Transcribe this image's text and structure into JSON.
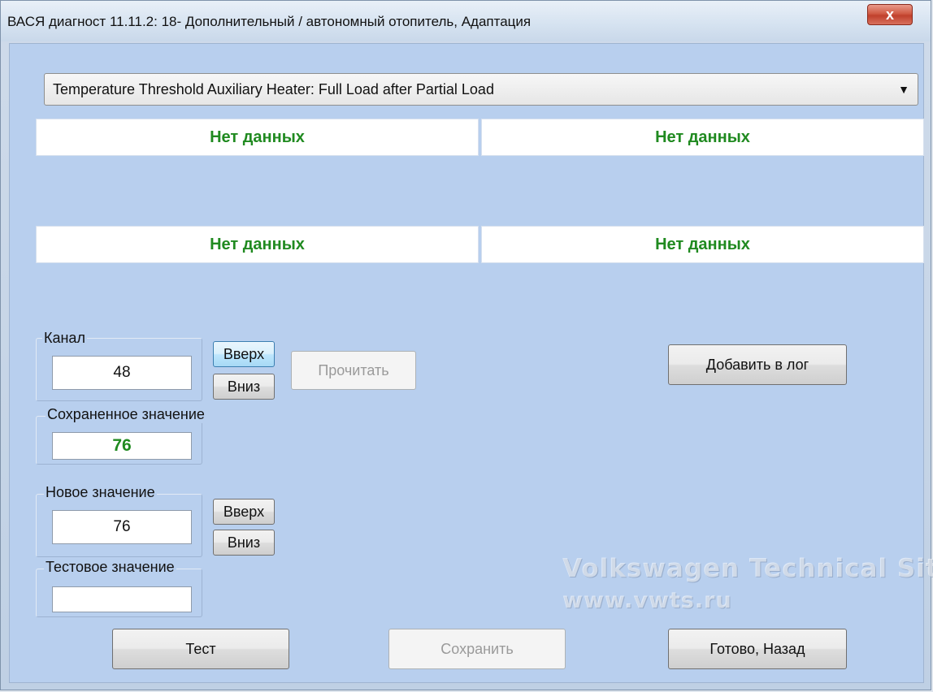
{
  "window": {
    "title": "ВАСЯ диагност 11.11.2: 18- Дополнительный / автономный отопитель, Адаптация",
    "close_label": "x"
  },
  "dropdown": {
    "selected": "Temperature Threshold Auxiliary Heater: Full Load after Partial Load"
  },
  "panels": [
    "Нет данных",
    "Нет данных",
    "Нет данных",
    "Нет данных"
  ],
  "channel": {
    "label": "Канал",
    "value": "48",
    "up_label": "Вверх",
    "down_label": "Вниз",
    "read_label": "Прочитать"
  },
  "stored": {
    "label": "Сохраненное значение",
    "value": "76"
  },
  "new_value": {
    "label": "Новое значение",
    "value": "76",
    "up_label": "Вверх",
    "down_label": "Вниз"
  },
  "test_value": {
    "label": "Тестовое значение",
    "value": ""
  },
  "buttons": {
    "add_to_log": "Добавить в лог",
    "test": "Тест",
    "save": "Сохранить",
    "done_back": "Готово, Назад"
  },
  "watermark": {
    "line1": "Volkswagen Technical Site",
    "line2": "www.vwts.ru"
  },
  "colors": {
    "data_text": "#208a20",
    "client_bg": "#b8cfee"
  }
}
